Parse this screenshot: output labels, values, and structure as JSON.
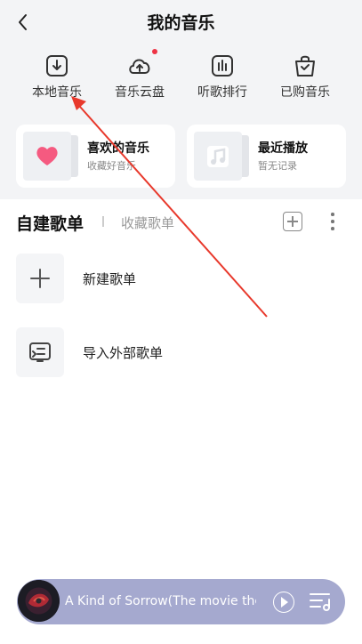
{
  "header": {
    "title": "我的音乐",
    "back_icon": "chevron-left-icon"
  },
  "quick_actions": [
    {
      "label": "本地音乐",
      "icon": "download-box-icon"
    },
    {
      "label": "音乐云盘",
      "icon": "cloud-upload-icon",
      "badge": "red-dot"
    },
    {
      "label": "听歌排行",
      "icon": "bar-chart-icon"
    },
    {
      "label": "已购音乐",
      "icon": "shopping-bag-icon"
    }
  ],
  "cards": {
    "liked": {
      "title": "喜欢的音乐",
      "subtitle": "收藏好音乐",
      "icon": "heart-icon",
      "icon_color": "#f55a80"
    },
    "recent": {
      "title": "最近播放",
      "subtitle": "暂无记录",
      "icon": "music-note-icon"
    }
  },
  "tabs": {
    "self_created": "自建歌单",
    "favorited": "收藏歌单"
  },
  "rows": [
    {
      "label": "新建歌单",
      "icon": "plus-icon"
    },
    {
      "label": "导入外部歌单",
      "icon": "import-icon"
    }
  ],
  "player": {
    "song_title": "A Kind of Sorrow(The movie them...",
    "accent": "#a5a9cf"
  },
  "annotation": {
    "arrow_color": "#e8392c"
  }
}
